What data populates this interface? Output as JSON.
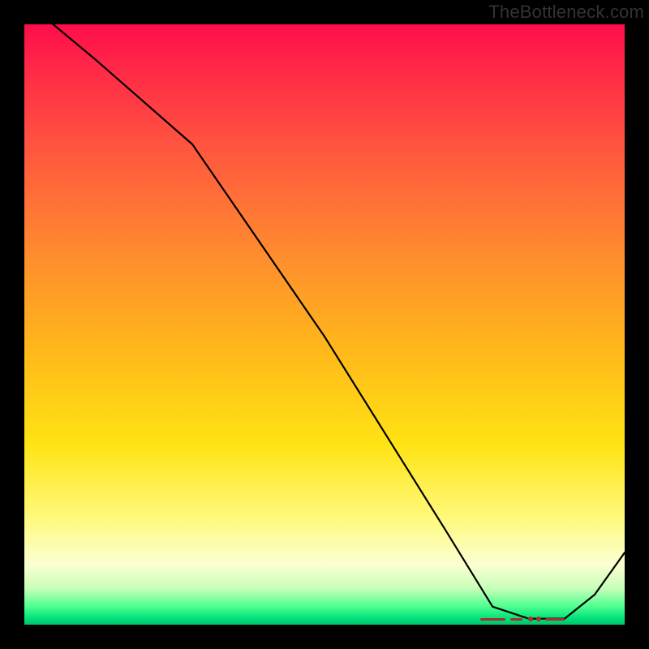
{
  "attribution": "TheBottleneck.com",
  "chart_data": {
    "type": "line",
    "title": "",
    "xlabel": "",
    "ylabel": "",
    "xlim": [
      0,
      100
    ],
    "ylim": [
      0,
      100
    ],
    "series": [
      {
        "name": "curve",
        "x": [
          0,
          12,
          28,
          50,
          70,
          78,
          84,
          90,
          95,
          100
        ],
        "y": [
          104,
          94,
          80,
          48,
          16,
          3,
          1,
          1,
          5,
          12
        ]
      }
    ],
    "optimal_band": {
      "x_start": 76,
      "x_end": 90,
      "y": 1
    },
    "background_gradient": {
      "top": "#ff0d4a",
      "mid_upper": "#ff8b2e",
      "mid": "#ffe314",
      "mid_lower": "#fbffd2",
      "bottom": "#00c468"
    },
    "curve_color": "#000000",
    "marker_color": "#b02a2a"
  }
}
